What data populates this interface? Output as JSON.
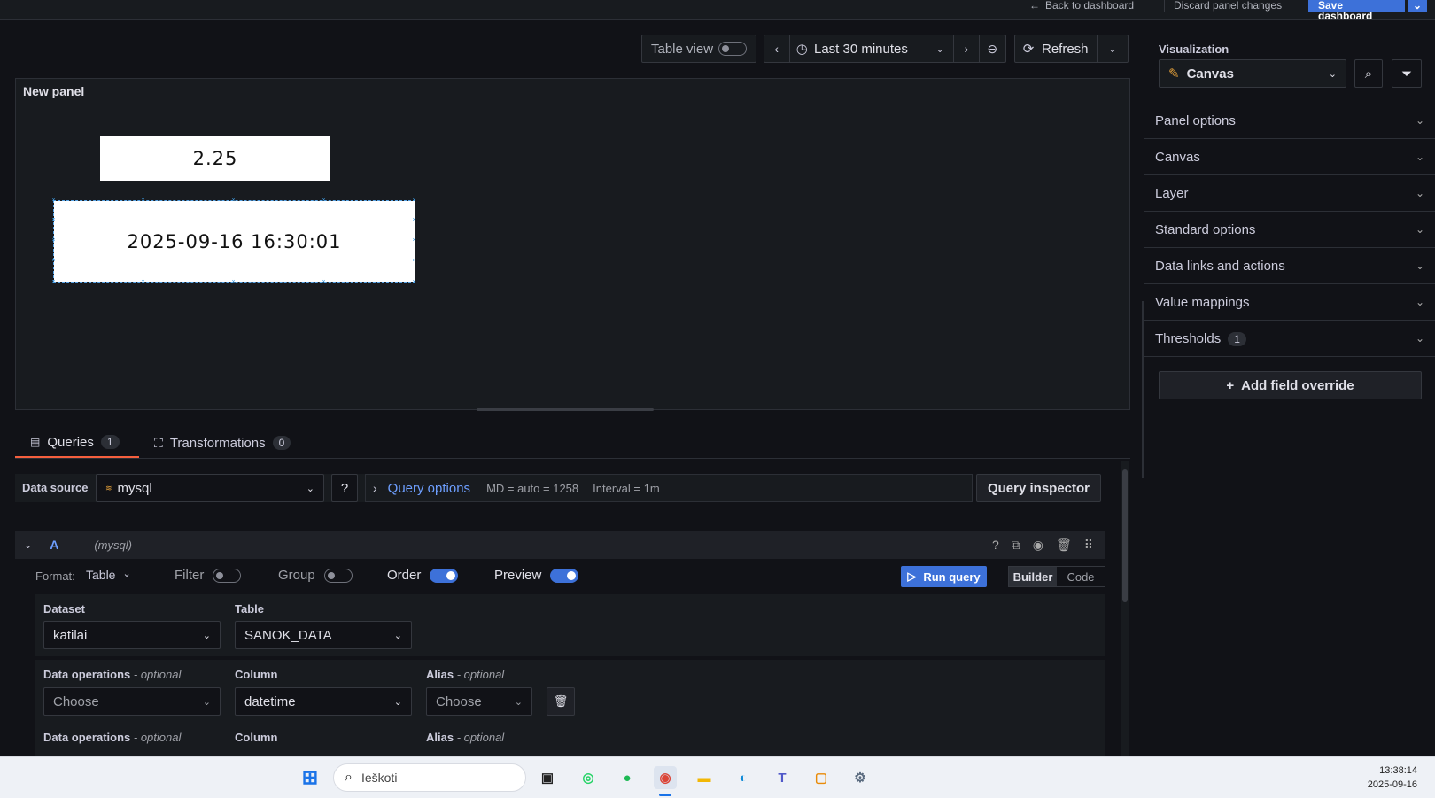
{
  "topbar": {
    "back": "Back to dashboard",
    "discard": "Discard panel changes",
    "save": "Save dashboard"
  },
  "toolbar": {
    "table_view": "Table view",
    "time_range": "Last 30 minutes",
    "refresh": "Refresh"
  },
  "panel": {
    "title": "New panel",
    "value": "2.25",
    "datetime": "2025-09-16 16:30:01"
  },
  "sidebar": {
    "viz_label": "Visualization",
    "viz_value": "Canvas",
    "sections": [
      "Panel options",
      "Canvas",
      "Layer",
      "Standard options",
      "Data links and actions",
      "Value mappings",
      "Thresholds"
    ],
    "thresholds_count": "1",
    "add_override": "Add field override"
  },
  "tabs": {
    "queries": "Queries",
    "queries_count": "1",
    "transformations": "Transformations",
    "transformations_count": "0"
  },
  "query_header": {
    "data_source_label": "Data source",
    "data_source": "mysql",
    "query_options": "Query options",
    "md": "MD = auto = 1258",
    "interval": "Interval = 1m",
    "inspector": "Query inspector"
  },
  "query": {
    "ref_id": "A",
    "ds": "(mysql)",
    "format_label": "Format:",
    "format_value": "Table",
    "filter": "Filter",
    "group": "Group",
    "order": "Order",
    "preview": "Preview",
    "run": "Run query",
    "builder": "Builder",
    "code": "Code",
    "dataset_label": "Dataset",
    "dataset": "katilai",
    "table_label": "Table",
    "table": "SANOK_DATA",
    "rows": [
      {
        "ops_label": "Data operations",
        "optional": "- optional",
        "ops_value": "Choose",
        "column_label": "Column",
        "column_value": "datetime",
        "alias_label": "Alias",
        "alias_value": "Choose"
      },
      {
        "ops_label": "Data operations",
        "optional": "- optional",
        "column_label": "Column",
        "alias_label": "Alias"
      }
    ]
  },
  "taskbar": {
    "search": "Ieškoti",
    "time": "13:38:14",
    "date": "2025-09-16"
  },
  "colors": {
    "accent": "#3d71d9",
    "bg": "#111217",
    "panel": "#181b1f"
  }
}
